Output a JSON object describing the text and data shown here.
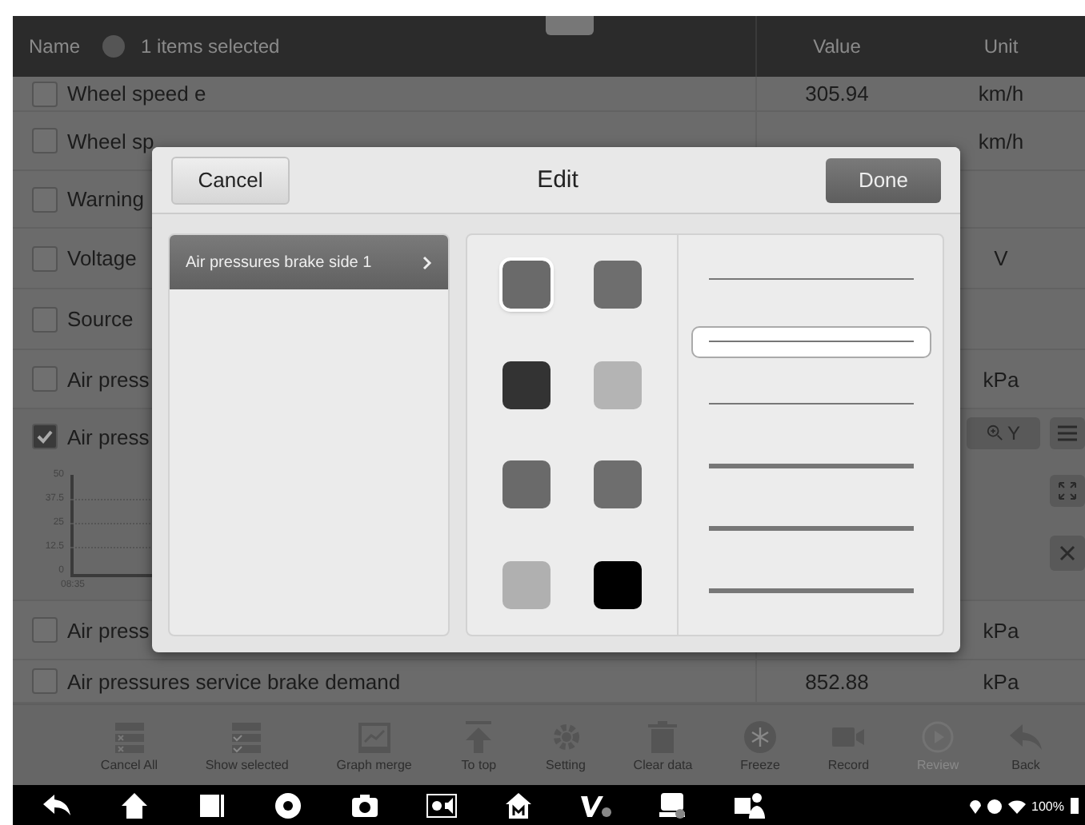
{
  "header": {
    "name_label": "Name",
    "selection_status": "1 items selected",
    "value_label": "Value",
    "unit_label": "Unit"
  },
  "rows": [
    {
      "name": "Wheel speed e",
      "value": "305.94",
      "unit": "km/h",
      "checked": false
    },
    {
      "name": "Wheel sp",
      "unit": "km/h",
      "checked": false
    },
    {
      "name": "Warning",
      "checked": false
    },
    {
      "name": "Voltage",
      "unit": "V",
      "checked": false
    },
    {
      "name": "Source",
      "checked": false
    },
    {
      "name": "Air press",
      "unit": "kPa",
      "checked": false
    },
    {
      "name": "Air press",
      "checked": true,
      "chart": {
        "y_labels": [
          "50",
          "37.5",
          "25",
          "12.5",
          "0"
        ],
        "x_label": "08:35",
        "zoom_label": "Y"
      }
    },
    {
      "name": "Air press",
      "unit": "kPa",
      "checked": false
    },
    {
      "name": "Air pressures service brake demand",
      "value": "852.88",
      "unit": "kPa",
      "checked": false
    }
  ],
  "dialog": {
    "title": "Edit",
    "cancel": "Cancel",
    "done": "Done",
    "items": [
      {
        "label": "Air pressures brake side 1",
        "selected": true
      }
    ],
    "colors": [
      {
        "color": "#6a6a6a",
        "selected": true
      },
      {
        "color": "#6e6e6e",
        "selected": false
      },
      {
        "color": "#333333",
        "selected": false
      },
      {
        "color": "#b4b4b4",
        "selected": false
      },
      {
        "color": "#6a6a6a",
        "selected": false
      },
      {
        "color": "#6e6e6e",
        "selected": false
      },
      {
        "color": "#b0b0b0",
        "selected": false
      },
      {
        "color": "#000000",
        "selected": false
      }
    ],
    "line_styles": [
      {
        "selected": false
      },
      {
        "selected": true
      },
      {
        "selected": false
      },
      {
        "selected": false
      },
      {
        "selected": false
      },
      {
        "selected": false
      }
    ]
  },
  "toolbar": [
    {
      "label": "Cancel All",
      "disabled": false
    },
    {
      "label": "Show selected",
      "disabled": false
    },
    {
      "label": "Graph merge",
      "disabled": false
    },
    {
      "label": "To top",
      "disabled": false
    },
    {
      "label": "Setting",
      "disabled": false
    },
    {
      "label": "Clear data",
      "disabled": false
    },
    {
      "label": "Freeze",
      "disabled": false
    },
    {
      "label": "Record",
      "disabled": false
    },
    {
      "label": "Review",
      "disabled": true
    },
    {
      "label": "Back",
      "disabled": false
    }
  ],
  "status_bar": {
    "battery": "100%"
  }
}
